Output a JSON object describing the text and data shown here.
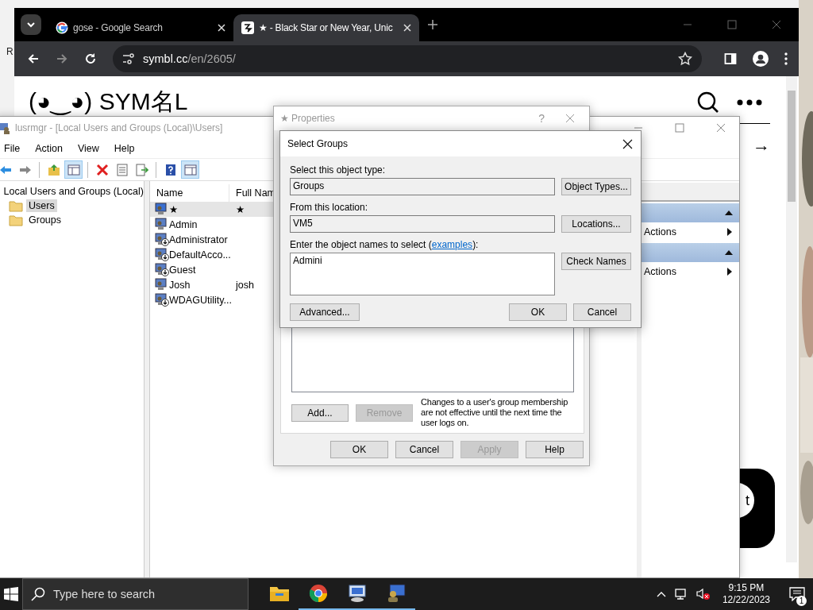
{
  "desktop": {
    "icon_label": "R"
  },
  "browser": {
    "tabs": [
      {
        "kind": "google",
        "title": "gose - Google Search",
        "selected": false
      },
      {
        "kind": "symbl",
        "title": "★ - Black Star or New Year, Unic",
        "selected": true
      }
    ],
    "address": {
      "host": "symbl.cc",
      "path": "/en/2605/"
    },
    "page": {
      "logo": "(◕‿◕) SYM名L",
      "arrow": "→",
      "chat_label": "t"
    }
  },
  "lusrmgr": {
    "title": "lusrmgr - [Local Users and Groups (Local)\\Users]",
    "active": false,
    "menu": [
      "File",
      "Action",
      "View",
      "Help"
    ],
    "toolbar": [
      [
        {
          "kind": "back",
          "pressed": false
        },
        {
          "kind": "forward",
          "pressed": false
        }
      ],
      [
        {
          "kind": "up",
          "pressed": false
        },
        {
          "kind": "tree",
          "pressed": true
        }
      ],
      [
        {
          "kind": "delete",
          "pressed": false
        },
        {
          "kind": "properties",
          "pressed": false
        },
        {
          "kind": "export",
          "pressed": false
        }
      ],
      [
        {
          "kind": "help",
          "pressed": false
        },
        {
          "kind": "actions",
          "pressed": true
        }
      ]
    ],
    "tree": [
      {
        "label": "Local Users and Groups (Local)",
        "children": [
          {
            "label": "Users",
            "selected": true
          },
          {
            "label": "Groups",
            "selected": false
          }
        ]
      }
    ],
    "columns": [
      "Name",
      "Full Nam"
    ],
    "rows": [
      {
        "name": "★",
        "full_name": "★",
        "selected": true,
        "disabled": false
      },
      {
        "name": "Admin",
        "selected": false,
        "disabled": false
      },
      {
        "name": "Administrator",
        "selected": false,
        "disabled": true
      },
      {
        "name": "DefaultAcco...",
        "selected": false,
        "disabled": true
      },
      {
        "name": "Guest",
        "selected": false,
        "disabled": true
      },
      {
        "name": "Josh",
        "full_name": "josh",
        "selected": false,
        "disabled": false
      },
      {
        "name": "WDAGUtility...",
        "selected": false,
        "disabled": true
      }
    ],
    "action_sections": [
      {
        "expanded": true,
        "items": [
          "Actions"
        ]
      },
      {
        "expanded": true,
        "items": [
          "Actions"
        ]
      }
    ]
  },
  "properties": {
    "title": "★ Properties",
    "help": "?",
    "list_buttons": [
      {
        "label": "Add...",
        "disabled": false
      },
      {
        "label": "Remove",
        "disabled": true
      }
    ],
    "note": "Changes to a user's group membership are not effective until the next time the user logs on.",
    "footer": [
      {
        "label": "OK",
        "disabled": false
      },
      {
        "label": "Cancel",
        "disabled": false
      },
      {
        "label": "Apply",
        "disabled": true
      },
      {
        "label": "Help",
        "disabled": false
      }
    ]
  },
  "select_groups": {
    "title": "Select Groups",
    "object_type_label": "Select this object type:",
    "object_type": "Groups",
    "object_types_button": "Object Types...",
    "location_label": "From this location:",
    "location": "VM5",
    "locations_button": "Locations...",
    "names_label_before": "Enter the object names to select (",
    "names_link": "examples",
    "names_label_after": "):",
    "names_value": "Admini",
    "check_names_button": "Check Names",
    "advanced_button": "Advanced...",
    "ok_button": "OK",
    "cancel_button": "Cancel"
  },
  "taskbar": {
    "search_placeholder": "Type here to search",
    "apps": [
      {
        "kind": "explorer",
        "running": false
      },
      {
        "kind": "chrome",
        "running": true
      },
      {
        "kind": "computer",
        "running": true
      },
      {
        "kind": "users",
        "running": true
      }
    ],
    "time": "9:15 PM",
    "date": "12/22/2023",
    "notifications": "1"
  }
}
